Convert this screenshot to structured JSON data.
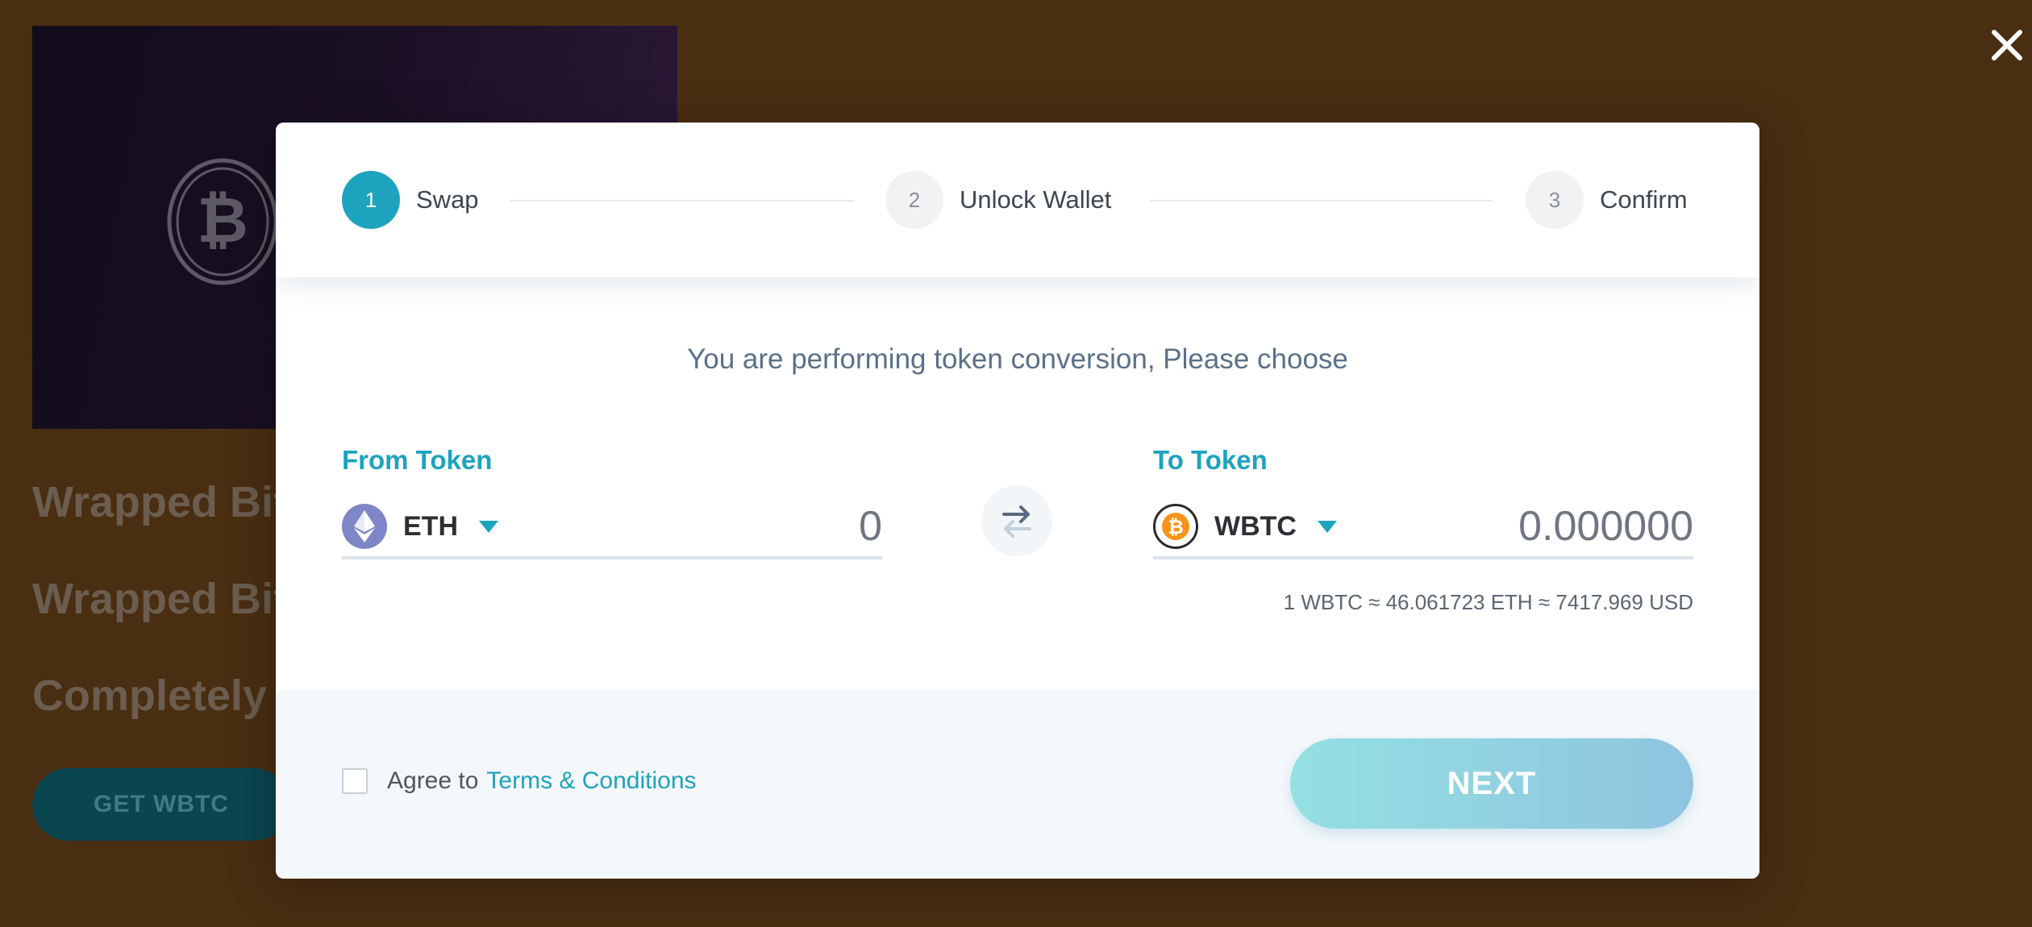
{
  "background": {
    "line1": "Wrapped Bit",
    "line2": "Wrapped Bit",
    "line3": "Completely t",
    "cta": "GET WBTC"
  },
  "steps": [
    {
      "num": "1",
      "label": "Swap"
    },
    {
      "num": "2",
      "label": "Unlock Wallet"
    },
    {
      "num": "3",
      "label": "Confirm"
    }
  ],
  "subtitle": "You are performing token conversion, Please choose",
  "from": {
    "label": "From Token",
    "token": "ETH",
    "amount": "0"
  },
  "to": {
    "label": "To Token",
    "token": "WBTC",
    "amount": "0.000000"
  },
  "rate": "1 WBTC ≈ 46.061723 ETH ≈ 7417.969 USD",
  "footer": {
    "agree": "Agree to",
    "terms": "Terms & Conditions",
    "next": "NEXT"
  },
  "colors": {
    "accent": "#1da3bd",
    "background": "#4a2e12"
  }
}
